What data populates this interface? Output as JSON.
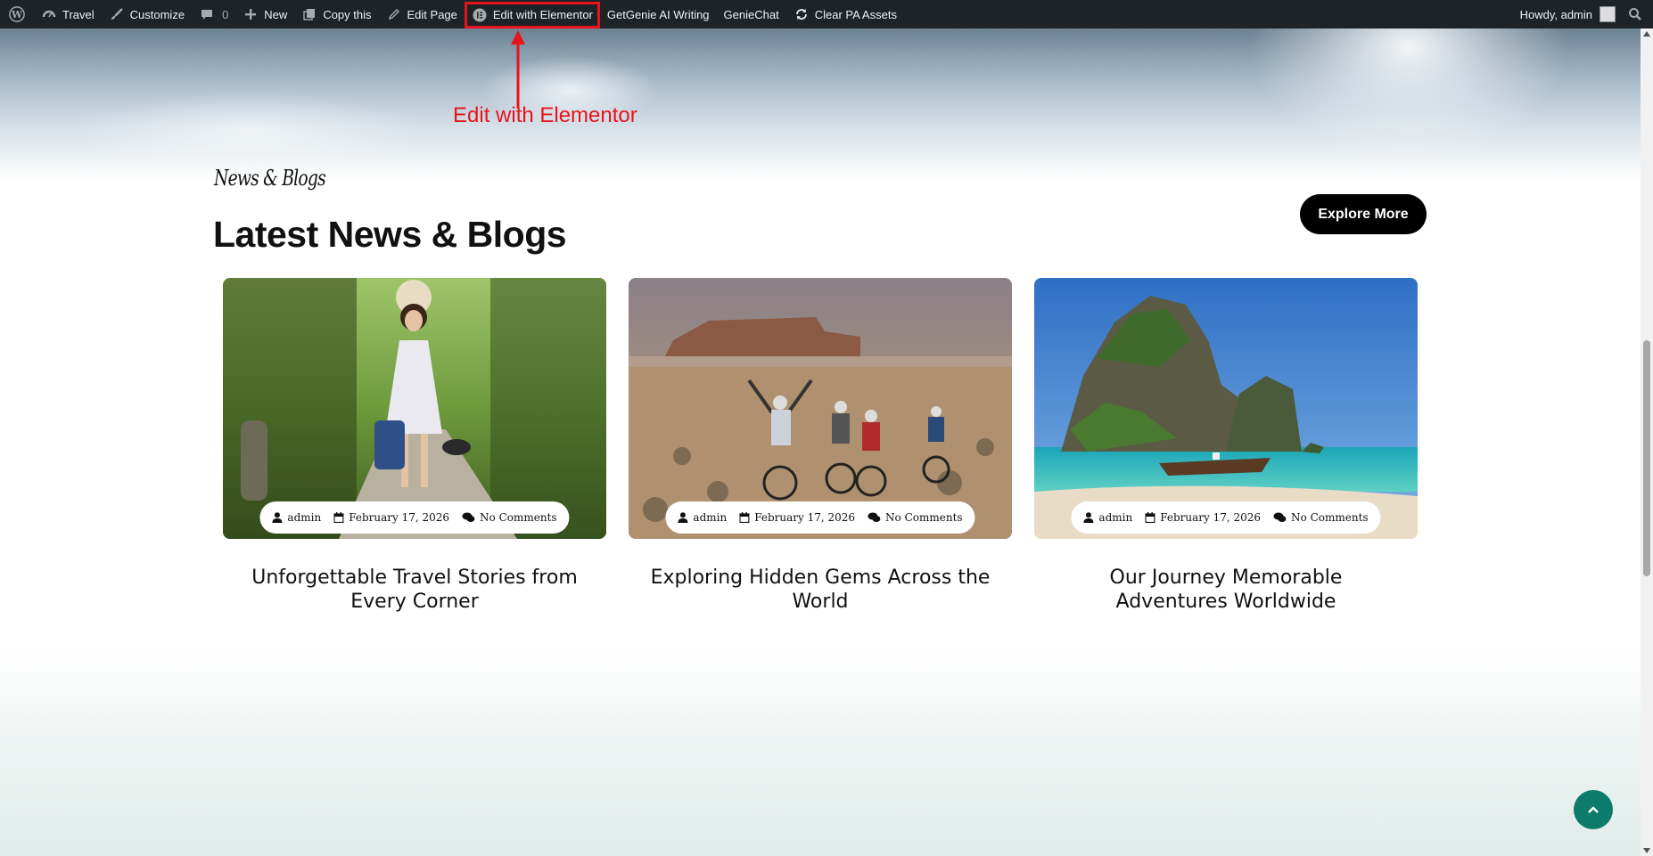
{
  "admin_bar": {
    "site_name": "Travel",
    "customize": "Customize",
    "comments_count": "0",
    "new": "New",
    "copy_this": "Copy this",
    "edit_page": "Edit Page",
    "edit_with_elementor": "Edit with Elementor",
    "getgenie": "GetGenie AI Writing",
    "geniechat": "GenieChat",
    "clear_pa_assets": "Clear PA Assets",
    "howdy": "Howdy, admin"
  },
  "annotation": {
    "label": "Edit with Elementor",
    "color": "#e8131b"
  },
  "section": {
    "eyebrow": "News & Blogs",
    "title": "Latest News & Blogs",
    "explore_button": "Explore More"
  },
  "posts": [
    {
      "author": "admin",
      "date": "February 17, 2026",
      "comments": "No Comments",
      "title": "Unforgettable Travel Stories from Every Corner"
    },
    {
      "author": "admin",
      "date": "February 17, 2026",
      "comments": "No Comments",
      "title": "Exploring Hidden Gems Across the World"
    },
    {
      "author": "admin",
      "date": "February 17, 2026",
      "comments": "No Comments",
      "title": "Our Journey Memorable Adventures Worldwide"
    }
  ],
  "colors": {
    "admin_bar_bg": "#1d2327",
    "button_bg": "#000000",
    "back_to_top": "#0c7b6b"
  },
  "icons": [
    "wordpress-icon",
    "dashboard-icon",
    "brush-icon",
    "comment-icon",
    "plus-icon",
    "copy-icon",
    "pencil-icon",
    "elementor-icon",
    "refresh-icon",
    "search-icon",
    "user-icon",
    "calendar-icon",
    "comments-icon",
    "chevron-up-icon"
  ]
}
